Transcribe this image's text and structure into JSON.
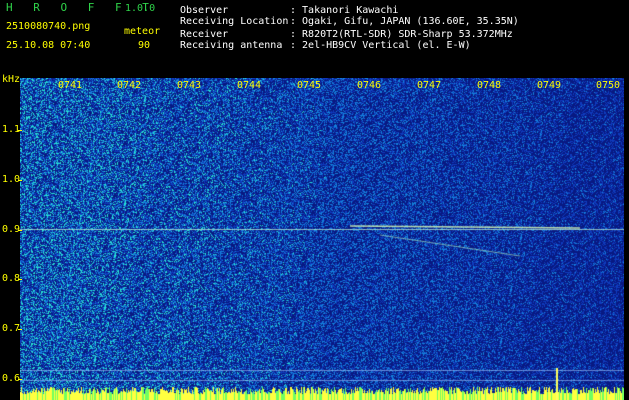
{
  "header": {
    "app_title": "H R O F F T",
    "version": "1.0.0",
    "filename": "2510080740.png",
    "mode": "meteor",
    "datetime": "25.10.08 07:40",
    "count": "90"
  },
  "station": [
    {
      "label": "Observer",
      "value": ": Takanori Kawachi"
    },
    {
      "label": "Receiving Location",
      "value": ": Ogaki, Gifu, JAPAN (136.60E, 35.35N)"
    },
    {
      "label": "Receiver",
      "value": ": R820T2(RTL-SDR) SDR-Sharp 53.372MHz"
    },
    {
      "label": "Receiving antenna",
      "value": ": 2el-HB9CV Vertical (el. E-W)"
    }
  ],
  "spectrogram": {
    "y_unit": "kHz",
    "y_ticks": [
      "1.1",
      "1.0",
      "0.9",
      "0.8",
      "0.7",
      "0.6"
    ],
    "time_labels": [
      "0741",
      "0742",
      "0743",
      "0744",
      "0745",
      "0746",
      "0747",
      "0748",
      "0749",
      "0750"
    ]
  },
  "colors": {
    "text_green": "#2fd34a",
    "text_yellow": "#ffff00",
    "text_white": "#ffffff",
    "background": "#000000"
  }
}
